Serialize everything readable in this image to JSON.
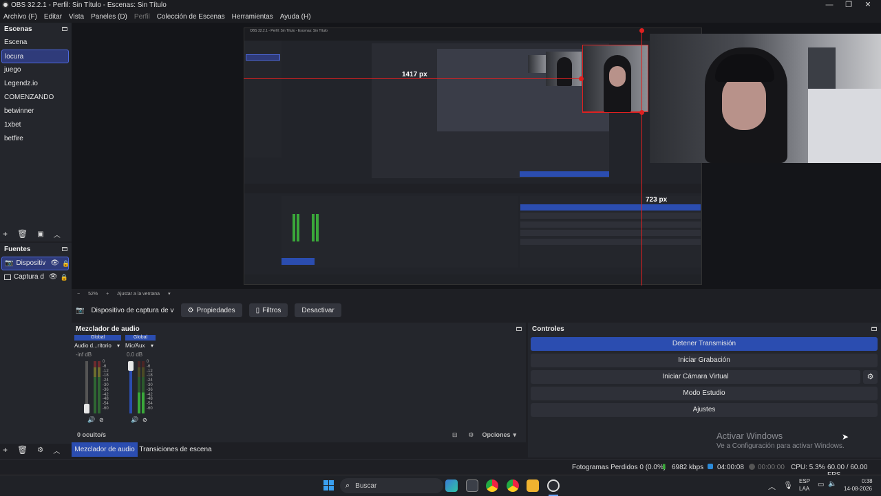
{
  "window": {
    "title": "OBS 32.2.1 - Perfil: Sin Título - Escenas: Sin Título"
  },
  "menu": [
    {
      "label": "Archivo (F)",
      "dim": false
    },
    {
      "label": "Editar",
      "dim": false
    },
    {
      "label": "Vista",
      "dim": false
    },
    {
      "label": "Paneles (D)",
      "dim": false
    },
    {
      "label": "Perfil",
      "dim": true
    },
    {
      "label": "Colección de Escenas",
      "dim": false
    },
    {
      "label": "Herramientas",
      "dim": false
    },
    {
      "label": "Ayuda (H)",
      "dim": false
    }
  ],
  "scenes": {
    "title": "Escenas",
    "items": [
      "Escena",
      "locura",
      "juego",
      "Legendz.io",
      "COMENZANDO",
      "betwinner",
      "1xbet",
      "betfire"
    ],
    "selected": "locura"
  },
  "sources": {
    "title": "Fuentes",
    "items": [
      {
        "label": "Dispositiv",
        "icon": "camera-icon",
        "selected": true
      },
      {
        "label": "Captura d",
        "icon": "monitor-icon",
        "selected": false
      }
    ]
  },
  "preview": {
    "measure_top": "1417 px",
    "measure_right": "723 px",
    "zoom": "52%",
    "fit_label": "Ajustar a la ventana"
  },
  "source_toolbar": {
    "source_name": "Dispositivo de captura de v",
    "properties": "Propiedades",
    "filters": "Filtros",
    "deactivate": "Desactivar"
  },
  "mixer": {
    "title": "Mezclador de audio",
    "channels": [
      {
        "badge": "Global",
        "name": "Audio d...ritorio",
        "db": "-inf dB"
      },
      {
        "badge": "Global",
        "name": "Mic/Aux",
        "db": "0.0 dB"
      }
    ],
    "scale": [
      "0",
      "-6",
      "-12",
      "-18",
      "-24",
      "-30",
      "-36",
      "-42",
      "-48",
      "-54",
      "-60"
    ],
    "hidden": "0 oculto/s",
    "options": "Opciones",
    "tab_active": "Mezclador de audio",
    "tab_other": "Transiciones de escena"
  },
  "controls": {
    "title": "Controles",
    "buttons": [
      "Detener Transmisión",
      "Iniciar Grabación",
      "Iniciar Cámara Virtual",
      "Modo Estudio",
      "Ajustes"
    ]
  },
  "watermark": {
    "line1": "Activar Windows",
    "line2": "Ve a Configuración para activar Windows."
  },
  "status": {
    "dropped": "Fotogramas Perdidos 0 (0.0%)",
    "bitrate": "6982 kbps",
    "stream_time": "04:00:08",
    "rec_time": "00:00:00",
    "cpu": "CPU: 5.3%",
    "fps": "60.00 / 60.00 FPS"
  },
  "taskbar": {
    "search": "Buscar",
    "lang1": "ESP",
    "lang2": "LAA",
    "time": "0:38",
    "date": "14-08-2026"
  },
  "colors": {
    "accent": "#2b4db0",
    "selection": "#4e69e0",
    "guide": "#e02020",
    "meter_green": "#3aa83a",
    "meter_yellow": "#b8b830",
    "meter_red": "#b83030"
  }
}
